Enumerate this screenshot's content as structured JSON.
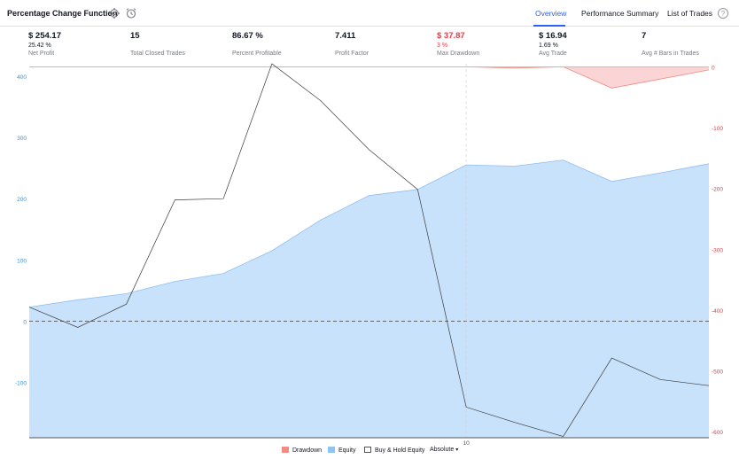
{
  "header": {
    "title": "Percentage Change Function",
    "tabs": [
      {
        "label": "Overview",
        "active": true
      },
      {
        "label": "Performance Summary",
        "active": false
      },
      {
        "label": "List of Trades",
        "active": false
      }
    ],
    "icons": [
      "gear-icon",
      "alarm-clock-icon",
      "help-icon"
    ]
  },
  "metrics": [
    {
      "value": "$ 254.17",
      "percent": "25.42 %",
      "label": "Net Profit",
      "negative": false
    },
    {
      "value": "15",
      "percent": "",
      "label": "Total Closed Trades",
      "negative": false
    },
    {
      "value": "86.67 %",
      "percent": "",
      "label": "Percent Profitable",
      "negative": false
    },
    {
      "value": "7.411",
      "percent": "",
      "label": "Profit Factor",
      "negative": false
    },
    {
      "value": "$ 37.87",
      "percent": "3 %",
      "label": "Max Drawdown",
      "negative": true
    },
    {
      "value": "$ 16.94",
      "percent": "1.69 %",
      "label": "Avg Trade",
      "negative": false
    },
    {
      "value": "7",
      "percent": "",
      "label": "Avg # Bars in Trades",
      "negative": false
    }
  ],
  "legend": {
    "drawdown": "Drawdown",
    "equity": "Equity",
    "buyhold": "Buy & Hold Equity",
    "mode": "Absolute"
  },
  "colors": {
    "equity_fill": "#c8e2fc",
    "equity_line": "#90bfee",
    "drawdown_fill": "#fbd5d5",
    "drawdown_line": "#f28b82",
    "buyhold_line": "#3a3a3a",
    "left_axis": "#2196f3",
    "right_axis": "#f23645",
    "accent": "#2962ff"
  },
  "chart_data": {
    "type": "area",
    "x": [
      1,
      2,
      3,
      4,
      5,
      6,
      7,
      8,
      9,
      10,
      11,
      12,
      13,
      14,
      15
    ],
    "x_ticks": [
      {
        "x": 10,
        "label": "10"
      }
    ],
    "left_axis": {
      "ticks": [
        400,
        300,
        200,
        100,
        0,
        -100
      ],
      "ylim": [
        -190,
        420
      ]
    },
    "right_axis": {
      "ticks": [
        0,
        -100,
        -200,
        -300,
        -400,
        -500,
        -600
      ],
      "ylim": [
        -610,
        5
      ]
    },
    "series": [
      {
        "name": "Equity",
        "axis": "left",
        "values": [
          23,
          35,
          45,
          65,
          78,
          115,
          165,
          205,
          215,
          255,
          253,
          263,
          228,
          242,
          257
        ]
      },
      {
        "name": "Buy & Hold Equity",
        "axis": "left",
        "values": [
          23,
          -10,
          28,
          198,
          200,
          420,
          360,
          280,
          215,
          -140,
          -165,
          -188,
          -60,
          -95,
          -105
        ]
      },
      {
        "name": "Drawdown",
        "axis": "right",
        "values": [
          0,
          0,
          0,
          0,
          0,
          0,
          0,
          0,
          0,
          0,
          -2,
          0,
          -35,
          -20,
          -5
        ]
      }
    ],
    "zero_line": 0,
    "grid": false
  }
}
